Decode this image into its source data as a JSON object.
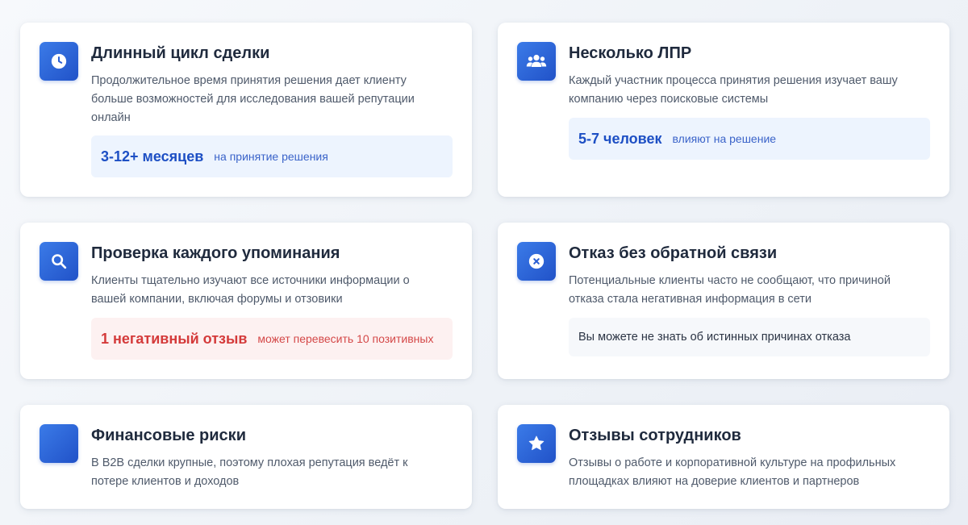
{
  "cards": [
    {
      "icon": "clock-icon",
      "title": "Длинный цикл сделки",
      "description": "Продолжительное время принятия решения дает клиенту больше возможностей для исследования вашей репутации онлайн",
      "highlight_value": "3-12+ месяцев",
      "highlight_note": "на принятие решения",
      "highlight_color": "#1d4fc4"
    },
    {
      "icon": "users-icon",
      "title": "Несколько ЛПР",
      "description": "Каждый участник процесса принятия решения изучает вашу компанию через поисковые системы",
      "highlight_value": "5-7 человек",
      "highlight_note": "влияют на решение",
      "highlight_color": "#1d4fc4"
    },
    {
      "icon": "search-icon",
      "title": "Проверка каждого упоминания",
      "description": "Клиенты тщательно изучают все источники информации о вашей компании, включая форумы и отзовики",
      "highlight_value": "1 негативный отзыв",
      "highlight_note": "может перевесить 10 позитивных",
      "highlight_color": "#d43a3a"
    },
    {
      "icon": "close-circle-icon",
      "title": "Отказ без обратной связи",
      "description": "Потенциальные клиенты часто не сообщают, что причиной отказа стала негативная информация в сети",
      "highlight_text": "Вы можете не знать об истинных причинах отказа"
    },
    {
      "icon": "blank-icon",
      "title": "Финансовые риски",
      "description": "В B2B сделки крупные, поэтому плохая репутация ведёт к потере клиентов и доходов"
    },
    {
      "icon": "star-icon",
      "title": "Отзывы сотрудников",
      "description": "Отзывы о работе и корпоративной культуре на профильных площадках влияют на доверие клиентов и партнеров"
    }
  ],
  "colors": {
    "icon_gradient_start": "#3b7be8",
    "icon_gradient_end": "#2152c8",
    "title": "#1f2a3d",
    "text": "#4f5a6b"
  }
}
